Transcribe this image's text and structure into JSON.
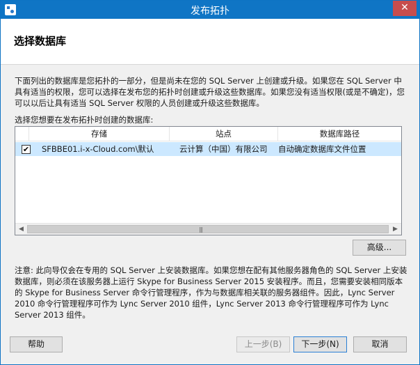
{
  "window": {
    "title": "发布拓扑",
    "close_label": "✕"
  },
  "header": {
    "title": "选择数据库"
  },
  "description": "下面列出的数据库是您拓扑的一部分，但是尚未在您的 SQL Server 上创建或升级。如果您在 SQL Server 中具有适当的权限，您可以选择在发布您的拓扑时创建或升级这些数据库。如果您没有适当权限(或是不确定)，您可以以后让具有适当 SQL Server 权限的人员创建或升级这些数据库。",
  "list": {
    "label": "选择您想要在发布拓扑时创建的数据库:",
    "columns": {
      "store": "存储",
      "site": "站点",
      "path": "数据库路径"
    },
    "rows": [
      {
        "checked": true,
        "check_mark": "✔",
        "store": "SFBBE01.i-x-Cloud.com\\默认",
        "site": "云计算（中国）有限公司",
        "path": "自动确定数据库文件位置"
      }
    ],
    "scroll_left": "◀",
    "scroll_right": "▶",
    "thumb_grip": "|||"
  },
  "advanced_button": "高级...",
  "note": "注意: 此向导仅会在专用的 SQL Server 上安装数据库。如果您想在配有其他服务器角色的 SQL Server 上安装数据库，则必须在该服务器上运行 Skype for Business Server 2015 安装程序。而且，您需要安装相同版本的 Skype for Business Server 命令行管理程序，作为与数据库相关联的服务器组件。因此，Lync Server 2010 命令行管理程序可作为 Lync Server 2010 组件，Lync Server 2013 命令行管理程序可作为 Lync Server 2013 组件。",
  "footer": {
    "help": "帮助",
    "back": "上一步(B)",
    "next": "下一步(N)",
    "cancel": "取消"
  }
}
